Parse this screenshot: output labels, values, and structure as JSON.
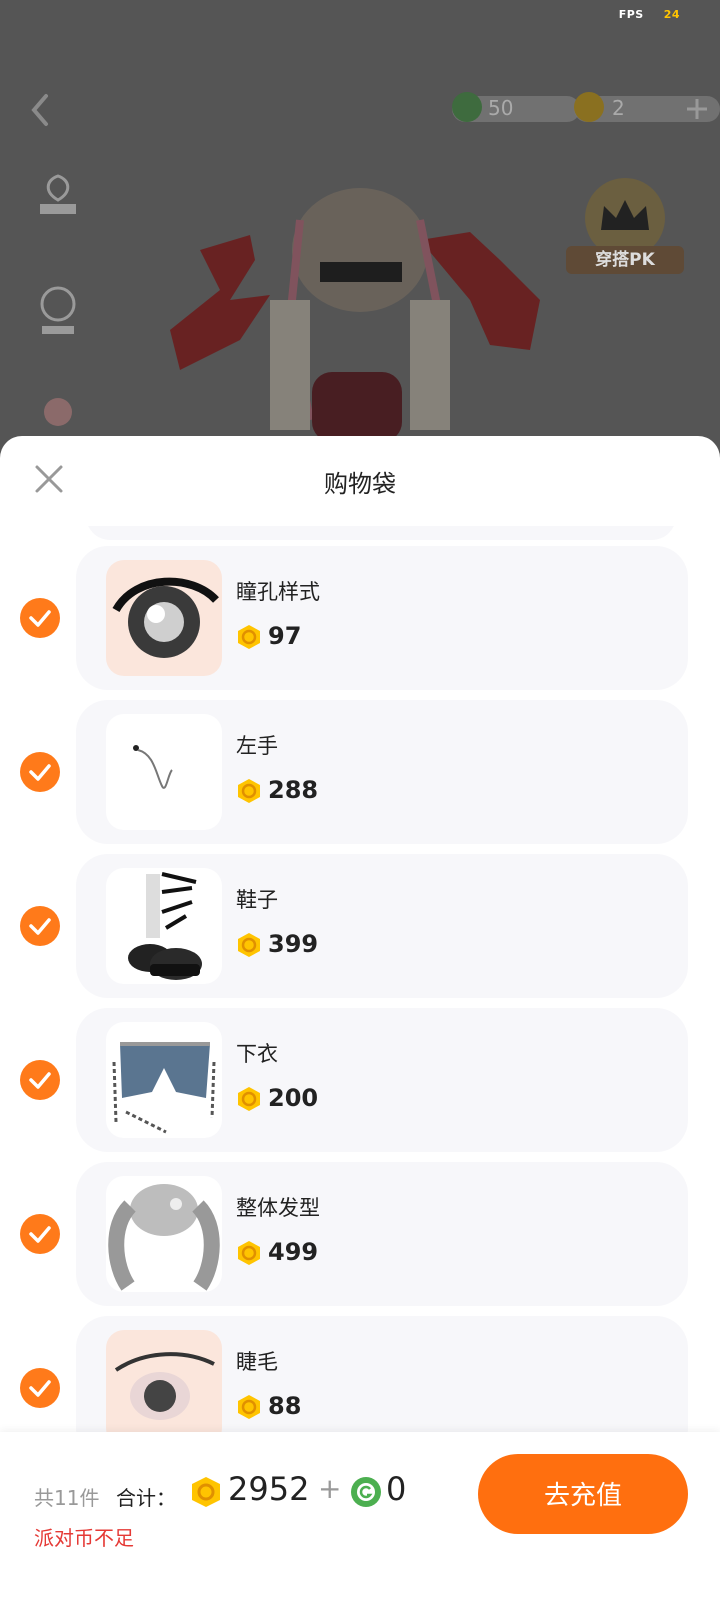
{
  "status": {
    "fps_label": "FPS",
    "fps_value": "24"
  },
  "scene": {
    "currency": [
      {
        "icon": "g-coin-icon",
        "value": "50"
      },
      {
        "icon": "gold-coin-icon",
        "value": "2"
      }
    ],
    "pk_badge_label": "穿搭PK"
  },
  "sheet": {
    "title": "购物袋",
    "items": [
      {
        "name": "瞳孔样式",
        "price": "97",
        "checked": true,
        "thumb": "pupil-icon"
      },
      {
        "name": "左手",
        "price": "288",
        "checked": true,
        "thumb": "left-hand-icon"
      },
      {
        "name": "鞋子",
        "price": "399",
        "checked": true,
        "thumb": "shoes-icon"
      },
      {
        "name": "下衣",
        "price": "200",
        "checked": true,
        "thumb": "shorts-icon"
      },
      {
        "name": "整体发型",
        "price": "499",
        "checked": true,
        "thumb": "hairstyle-icon"
      },
      {
        "name": "睫毛",
        "price": "88",
        "checked": true,
        "thumb": "eyelash-icon"
      }
    ]
  },
  "footer": {
    "count_label": "共11件",
    "total_label": "合计：",
    "total_coins": "2952",
    "plus": "+",
    "total_g_coins": "0",
    "warning": "派对币不足",
    "recharge_label": "去充值"
  },
  "colors": {
    "accent": "#ff6f0f",
    "warning": "#e53935",
    "coin": "#ffc400",
    "g_coin": "#4caf50"
  }
}
